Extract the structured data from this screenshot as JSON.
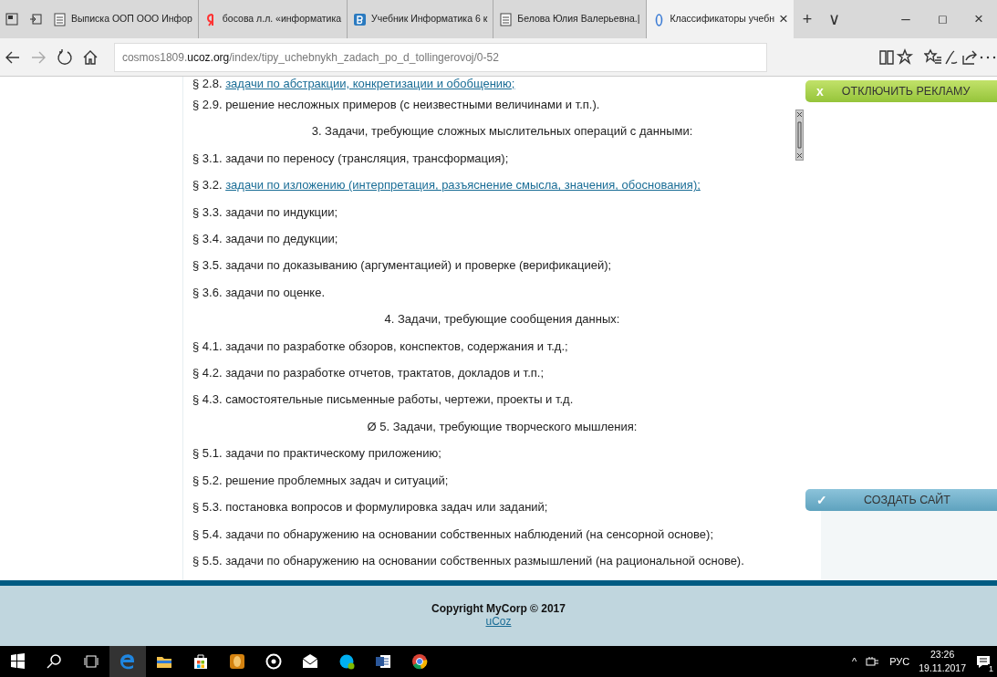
{
  "browser": {
    "tabs": [
      {
        "title": "Выписка ООП ООО Инфор",
        "selected": false
      },
      {
        "title": "босова л.л. «информатика",
        "selected": false
      },
      {
        "title": "Учебник Информатика 6 к",
        "selected": false
      },
      {
        "title": "Белова Юлия Валерьевна.|",
        "selected": false
      },
      {
        "title": "Классификаторы учебн",
        "selected": true
      }
    ],
    "close_tab": "×",
    "new_tab": "+",
    "tab_menu": "∨",
    "window_controls": [
      "–",
      "◻",
      "×"
    ],
    "address": {
      "subdomain": "cosmos1809.",
      "domain": "ucoz.org",
      "path": "/index/tipy_uchebnykh_zadach_po_d_tollingerovoj/0-52"
    }
  },
  "content": [
    {
      "kind": "link",
      "marker": "§ 2.8.",
      "link": "задачи по абстракции, конкретизации и обобщению;"
    },
    {
      "kind": "item",
      "text": "§ 2.9. решение несложных примеров (с неизвестными величинами и т.п.)."
    },
    {
      "kind": "heading",
      "text": "3. Задачи, требующие сложных мыслительных операций с данными:"
    },
    {
      "kind": "item",
      "text": "§ 3.1. задачи по переносу (трансляция, трансформация);"
    },
    {
      "kind": "link",
      "marker": "§ 3.2.",
      "link": "задачи по изложению (интерпретация, разъяснение смысла, значения, обоснования);"
    },
    {
      "kind": "item",
      "text": "§ 3.3. задачи по индукции;"
    },
    {
      "kind": "item",
      "text": "§ 3.4. задачи по дедукции;"
    },
    {
      "kind": "item",
      "text": "§ 3.5. задачи по доказыванию (аргументацией) и проверке (верификацией);"
    },
    {
      "kind": "item",
      "text": "§ 3.6. задачи по оценке."
    },
    {
      "kind": "heading",
      "text": "4. Задачи, требующие сообщения данных:"
    },
    {
      "kind": "item",
      "text": "§ 4.1. задачи по разработке обзоров, конспектов, содержания и т.д.;"
    },
    {
      "kind": "item",
      "text": "§ 4.2. задачи по разработке отчетов, трактатов, докладов и т.п.;"
    },
    {
      "kind": "item",
      "text": "§ 4.3. самостоятельные письменные работы, чертежи, проекты и т.д."
    },
    {
      "kind": "heading",
      "text": "Ø 5. Задачи, требующие творческого мышления:"
    },
    {
      "kind": "item",
      "text": "§ 5.1. задачи по практическому приложению;"
    },
    {
      "kind": "item",
      "text": "§ 5.2. решение проблемных задач и ситуаций;"
    },
    {
      "kind": "item",
      "text": "§ 5.3. постановка вопросов и формулировка задач или заданий;"
    },
    {
      "kind": "item",
      "text": "§ 5.4. задачи по обнаружению на основании собственных наблюдений (на сенсорной основе);"
    },
    {
      "kind": "item",
      "text": "§ 5.5. задачи по обнаружению на основании собственных размышлений (на рациональной основе)."
    }
  ],
  "ads": {
    "disable_ads": {
      "icon": "x",
      "label": "ОТКЛЮЧИТЬ РЕКЛАМУ"
    },
    "create_site": {
      "icon": "✓",
      "label": "СОЗДАТЬ САЙТ"
    }
  },
  "footer": {
    "copyright": "Copyright MyCorp © 2017",
    "link": "uCoz"
  },
  "taskbar": {
    "tray": {
      "chevron": "^",
      "language": "РУС",
      "time": "23:26",
      "date": "19.11.2017",
      "notifications": "1"
    }
  }
}
